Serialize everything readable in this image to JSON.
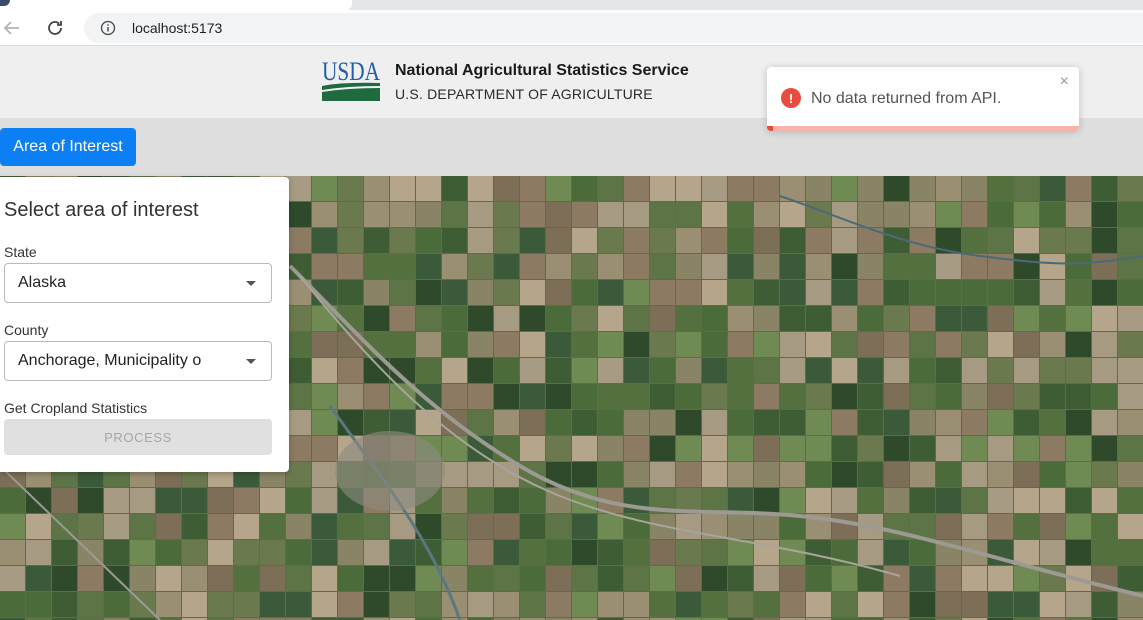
{
  "browser": {
    "url": "localhost:5173"
  },
  "header": {
    "logo_text": "USDA",
    "agency_name": "National Agricultural Statistics Service",
    "department": "U.S. DEPARTMENT OF AGRICULTURE",
    "aoi_button": "Area of Interest"
  },
  "panel": {
    "title": "Select area of interest",
    "state_label": "State",
    "state_value": "Alaska",
    "county_label": "County",
    "county_value": "Anchorage, Municipality o",
    "stats_label": "Get Cropland Statistics",
    "process_button": "PROCESS"
  },
  "toast": {
    "message": "No data returned from API.",
    "close": "×",
    "icon": "!",
    "progress": 0.02,
    "color": "#e74c3c"
  },
  "colors": {
    "accent": "#0d7ff5",
    "usda_blue": "#1e5fa8",
    "usda_green": "#1f6b3f"
  }
}
